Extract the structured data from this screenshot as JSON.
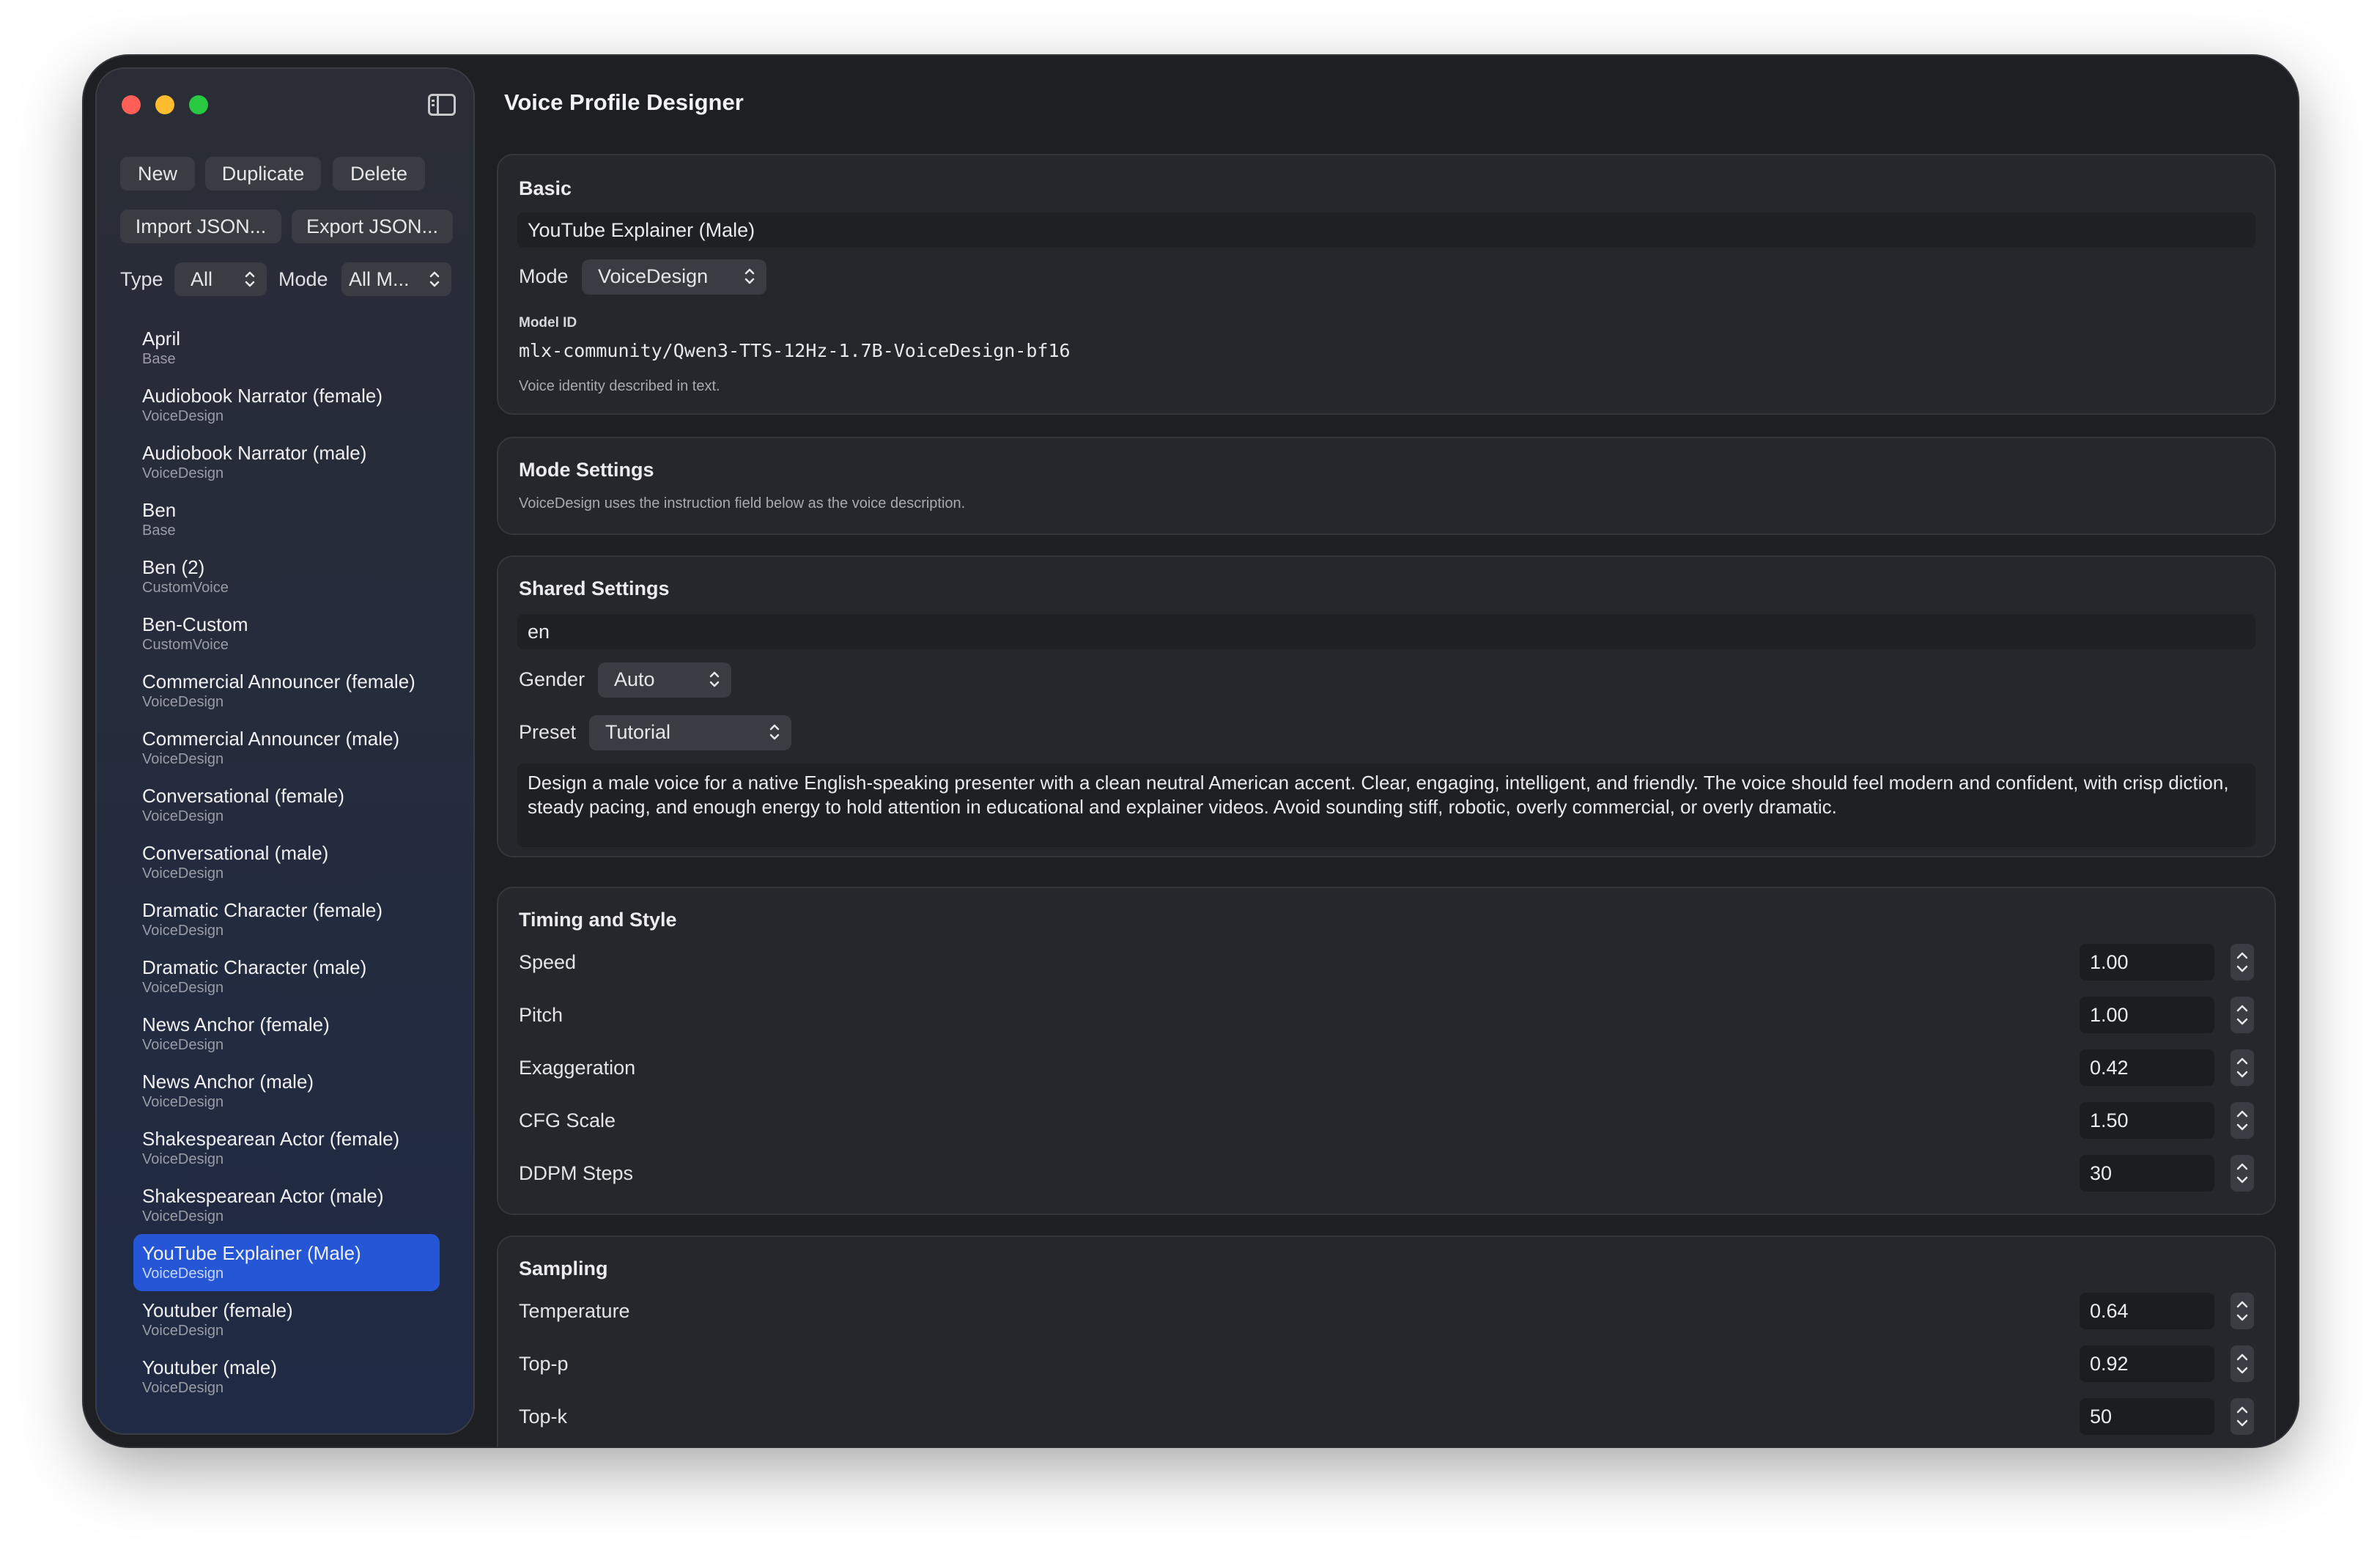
{
  "window": {
    "title": "Voice Profile Designer"
  },
  "toolbar": {
    "new_label": "New",
    "duplicate_label": "Duplicate",
    "delete_label": "Delete",
    "import_label": "Import JSON...",
    "export_label": "Export JSON..."
  },
  "filters": {
    "type_label": "Type",
    "type_value": "All",
    "mode_label": "Mode",
    "mode_value": "All M..."
  },
  "profiles": [
    {
      "name": "April",
      "kind": "Base"
    },
    {
      "name": "Audiobook Narrator (female)",
      "kind": "VoiceDesign"
    },
    {
      "name": "Audiobook Narrator (male)",
      "kind": "VoiceDesign"
    },
    {
      "name": "Ben",
      "kind": "Base"
    },
    {
      "name": "Ben (2)",
      "kind": "CustomVoice"
    },
    {
      "name": "Ben-Custom",
      "kind": "CustomVoice"
    },
    {
      "name": "Commercial Announcer (female)",
      "kind": "VoiceDesign"
    },
    {
      "name": "Commercial Announcer (male)",
      "kind": "VoiceDesign"
    },
    {
      "name": "Conversational (female)",
      "kind": "VoiceDesign"
    },
    {
      "name": "Conversational (male)",
      "kind": "VoiceDesign"
    },
    {
      "name": "Dramatic Character (female)",
      "kind": "VoiceDesign"
    },
    {
      "name": "Dramatic Character (male)",
      "kind": "VoiceDesign"
    },
    {
      "name": "News Anchor (female)",
      "kind": "VoiceDesign"
    },
    {
      "name": "News Anchor (male)",
      "kind": "VoiceDesign"
    },
    {
      "name": "Shakespearean Actor (female)",
      "kind": "VoiceDesign"
    },
    {
      "name": "Shakespearean Actor (male)",
      "kind": "VoiceDesign"
    },
    {
      "name": "YouTube Explainer  (Male)",
      "kind": "VoiceDesign",
      "selected": true
    },
    {
      "name": "Youtuber (female)",
      "kind": "VoiceDesign"
    },
    {
      "name": "Youtuber (male)",
      "kind": "VoiceDesign"
    }
  ],
  "basic": {
    "title": "Basic",
    "name_value": "YouTube Explainer  (Male)",
    "mode_label": "Mode",
    "mode_value": "VoiceDesign",
    "model_id_label": "Model ID",
    "model_id": "mlx-community/Qwen3-TTS-12Hz-1.7B-VoiceDesign-bf16",
    "caption": "Voice identity described in text."
  },
  "mode_settings": {
    "title": "Mode Settings",
    "caption": "VoiceDesign uses the instruction field below as the voice description."
  },
  "shared": {
    "title": "Shared Settings",
    "language_value": "en",
    "gender_label": "Gender",
    "gender_value": "Auto",
    "preset_label": "Preset",
    "preset_value": "Tutorial",
    "instruction": "Design a male voice for a native English-speaking presenter with a clean neutral American accent. Clear, engaging, intelligent, and friendly. The voice should feel modern and confident, with crisp diction, steady pacing, and enough energy to hold attention in educational and explainer videos. Avoid sounding stiff, robotic, overly commercial, or overly dramatic."
  },
  "timing": {
    "title": "Timing and Style",
    "rows": [
      {
        "label": "Speed",
        "value": "1.00"
      },
      {
        "label": "Pitch",
        "value": "1.00"
      },
      {
        "label": "Exaggeration",
        "value": "0.42"
      },
      {
        "label": "CFG Scale",
        "value": "1.50"
      },
      {
        "label": "DDPM Steps",
        "value": "30"
      }
    ]
  },
  "sampling": {
    "title": "Sampling",
    "rows": [
      {
        "label": "Temperature",
        "value": "0.64"
      },
      {
        "label": "Top-p",
        "value": "0.92"
      },
      {
        "label": "Top-k",
        "value": "50"
      }
    ]
  },
  "colors": {
    "accent": "#2456d6",
    "window_bg": "#1e1f23",
    "card_bg": "#26272c"
  }
}
